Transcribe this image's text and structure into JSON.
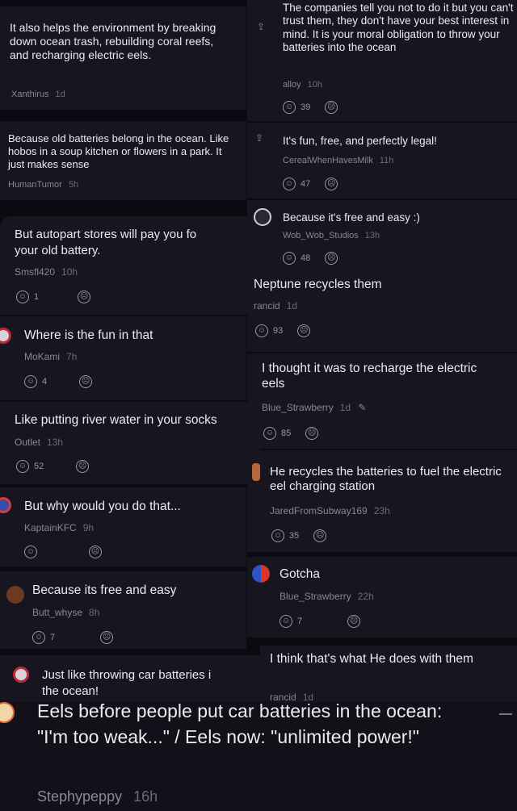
{
  "comments": [
    {
      "text": "It also helps the environment by breaking down ocean trash, rebuilding coral reefs, and recharging electric eels.",
      "user": "Xanthirus",
      "time": "1d"
    },
    {
      "text": "The companies tell you not to do it but you can't trust them, they don't have your best interest in mind. It is your moral obligation to throw your batteries into the ocean",
      "user": "alloy",
      "time": "10h",
      "likes": "39"
    },
    {
      "text": "Because old batteries belong in the ocean. Like hobos in a soup kitchen or flowers in a park. It just makes sense",
      "user": "HumanTumor",
      "time": "5h"
    },
    {
      "text": "It's fun, free, and perfectly legal!",
      "user": "CerealWhenHavesMilk",
      "time": "11h",
      "likes": "47"
    },
    {
      "text": "Because it's free and easy :)",
      "user": "Wob_Wob_Studios",
      "time": "13h",
      "likes": "48"
    },
    {
      "text": "But autopart stores will pay you fo",
      "text2": "your old battery.",
      "user": "Smsfl420",
      "time": "10h",
      "likes": "1"
    },
    {
      "text": "Neptune recycles them",
      "user": "rancid",
      "time": "1d",
      "likes": "93"
    },
    {
      "text": "Where is the fun in that",
      "user": "MoKami",
      "time": "7h",
      "likes": "4"
    },
    {
      "text": "I thought it was to recharge the electric eels",
      "user": "Blue_Strawberry",
      "time": "1d",
      "likes": "85"
    },
    {
      "text": "Like putting river water in your socks",
      "user": "Outlet",
      "time": "13h",
      "likes": "52"
    },
    {
      "text": "He recycles the batteries to fuel the electric eel charging station",
      "user": "JaredFromSubway169",
      "time": "23h",
      "likes": "35"
    },
    {
      "text": "But why would you do that...",
      "user": "KaptainKFC",
      "time": "9h"
    },
    {
      "text": "Gotcha",
      "user": "Blue_Strawberry",
      "time": "22h",
      "likes": "7"
    },
    {
      "text": "Because its free and easy",
      "user": "Butt_whyse",
      "time": "8h",
      "likes": "7"
    },
    {
      "text": "I think that's what He does with them",
      "user": "rancid",
      "time": "1d"
    },
    {
      "text": "Just like throwing car batteries i",
      "text2": "the ocean!"
    },
    {
      "text": "Eels before people put car batteries in the ocean: \"I'm too weak...\" / Eels now: \"unlimited power!\"",
      "user": "Stephypeppy",
      "time": "16h"
    }
  ],
  "icons": {
    "like": "smile-icon",
    "dislike": "frown-icon",
    "share": "share-icon",
    "edit": "pencil-icon"
  },
  "colors": {
    "background": "#0b0a10",
    "panel": "#17151f",
    "text": "#ecebf0",
    "meta": "#8a8696"
  }
}
